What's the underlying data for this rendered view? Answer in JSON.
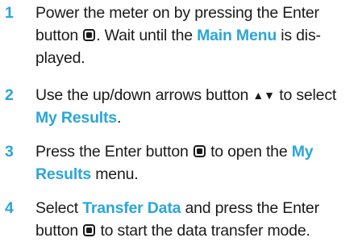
{
  "steps": [
    {
      "num": "1",
      "line1": {
        "text": "Power the meter on by pressing the Enter"
      },
      "line2": {
        "pre": "button ",
        "post": ". Wait until the ",
        "highlight": "Main Menu",
        "tail": " is dis-"
      },
      "line3": {
        "text": "played."
      }
    },
    {
      "num": "2",
      "line1": {
        "pre": "Use the up/down arrows button ",
        "arrows": "▲▼",
        "post": " to select"
      },
      "line2": {
        "highlight": "My Results",
        "tail": "."
      }
    },
    {
      "num": "3",
      "line1": {
        "pre": "Press the Enter button ",
        "post": " to open the ",
        "highlight": "My"
      },
      "line2": {
        "highlight": "Results",
        "tail": " menu."
      }
    },
    {
      "num": "4",
      "line1": {
        "pre": "Select ",
        "highlight": "Transfer Data",
        "post": " and press the Enter"
      },
      "line2": {
        "pre": "button ",
        "post": " to start the data transfer mode."
      }
    }
  ],
  "icons": {
    "enter_button": "enter-button-icon",
    "up_down_arrows": "up-down-arrows-icon"
  },
  "colors": {
    "accent": "#2aa6d8",
    "text": "#1a1a1a"
  }
}
